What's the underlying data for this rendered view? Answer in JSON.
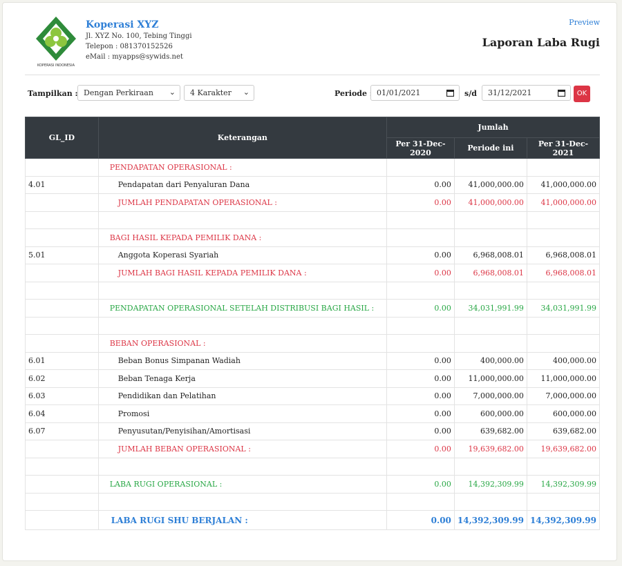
{
  "company": {
    "name": "Koperasi XYZ",
    "address": "Jl. XYZ No. 100, Tebing Tinggi",
    "phone": "Telepon : 081370152526",
    "email": "eMail : myapps@sywids.net",
    "logo_caption": "KOPERASI INDONESIA"
  },
  "header": {
    "preview": "Preview",
    "title": "Laporan Laba Rugi"
  },
  "filters": {
    "tampilkan_label": "Tampilkan :",
    "mode": "Dengan Perkiraan",
    "digits": "4 Karakter",
    "periode_label": "Periode :",
    "start_date": "01/01/2021",
    "sd_label": "s/d",
    "end_date": "31/12/2021",
    "ok_label": "OK"
  },
  "table": {
    "col_glid": "GL_ID",
    "col_ket": "Keterangan",
    "col_jumlah": "Jumlah",
    "col_prev": "Per 31-Dec-2020",
    "col_period": "Periode ini",
    "col_curr": "Per 31-Dec-2021",
    "rows": [
      {
        "kind": "header",
        "color": "red",
        "ket": "PENDAPATAN OPERASIONAL :"
      },
      {
        "kind": "item",
        "id": "4.01",
        "ket": "Pendapatan dari Penyaluran Dana",
        "a": "0.00",
        "b": "41,000,000.00",
        "c": "41,000,000.00"
      },
      {
        "kind": "total",
        "color": "red",
        "ket": "JUMLAH PENDAPATAN OPERASIONAL :",
        "a": "0.00",
        "b": "41,000,000.00",
        "c": "41,000,000.00"
      },
      {
        "kind": "blank"
      },
      {
        "kind": "header",
        "color": "red",
        "ket": "BAGI HASIL KEPADA PEMILIK DANA :"
      },
      {
        "kind": "item",
        "id": "5.01",
        "ket": "Anggota Koperasi Syariah",
        "a": "0.00",
        "b": "6,968,008.01",
        "c": "6,968,008.01"
      },
      {
        "kind": "total",
        "color": "red",
        "ket": "JUMLAH BAGI HASIL KEPADA PEMILIK DANA :",
        "a": "0.00",
        "b": "6,968,008.01",
        "c": "6,968,008.01"
      },
      {
        "kind": "blank"
      },
      {
        "kind": "summary",
        "color": "green",
        "ket": "PENDAPATAN OPERASIONAL SETELAH DISTRIBUSI BAGI HASIL :",
        "a": "0.00",
        "b": "34,031,991.99",
        "c": "34,031,991.99"
      },
      {
        "kind": "blank"
      },
      {
        "kind": "header",
        "color": "red",
        "ket": "BEBAN OPERASIONAL :"
      },
      {
        "kind": "item",
        "id": "6.01",
        "ket": "Beban Bonus Simpanan Wadiah",
        "a": "0.00",
        "b": "400,000.00",
        "c": "400,000.00"
      },
      {
        "kind": "item",
        "id": "6.02",
        "ket": "Beban Tenaga Kerja",
        "a": "0.00",
        "b": "11,000,000.00",
        "c": "11,000,000.00"
      },
      {
        "kind": "item",
        "id": "6.03",
        "ket": "Pendidikan dan Pelatihan",
        "a": "0.00",
        "b": "7,000,000.00",
        "c": "7,000,000.00"
      },
      {
        "kind": "item",
        "id": "6.04",
        "ket": "Promosi",
        "a": "0.00",
        "b": "600,000.00",
        "c": "600,000.00"
      },
      {
        "kind": "item",
        "id": "6.07",
        "ket": "Penyusutan/Penyisihan/Amortisasi",
        "a": "0.00",
        "b": "639,682.00",
        "c": "639,682.00"
      },
      {
        "kind": "total",
        "color": "red",
        "ket": "JUMLAH BEBAN OPERASIONAL :",
        "a": "0.00",
        "b": "19,639,682.00",
        "c": "19,639,682.00"
      },
      {
        "kind": "blank"
      },
      {
        "kind": "summary",
        "color": "green",
        "ket": "LABA RUGI OPERASIONAL :",
        "a": "0.00",
        "b": "14,392,309.99",
        "c": "14,392,309.99"
      },
      {
        "kind": "blank"
      },
      {
        "kind": "summary",
        "color": "blue",
        "ket": "LABA RUGI SHU BERJALAN :",
        "a": "0.00",
        "b": "14,392,309.99",
        "c": "14,392,309.99"
      }
    ]
  },
  "colors": {
    "accent": "#2e7fd6",
    "red": "#dc3545",
    "green": "#28a745",
    "header_bg": "#343a40"
  }
}
